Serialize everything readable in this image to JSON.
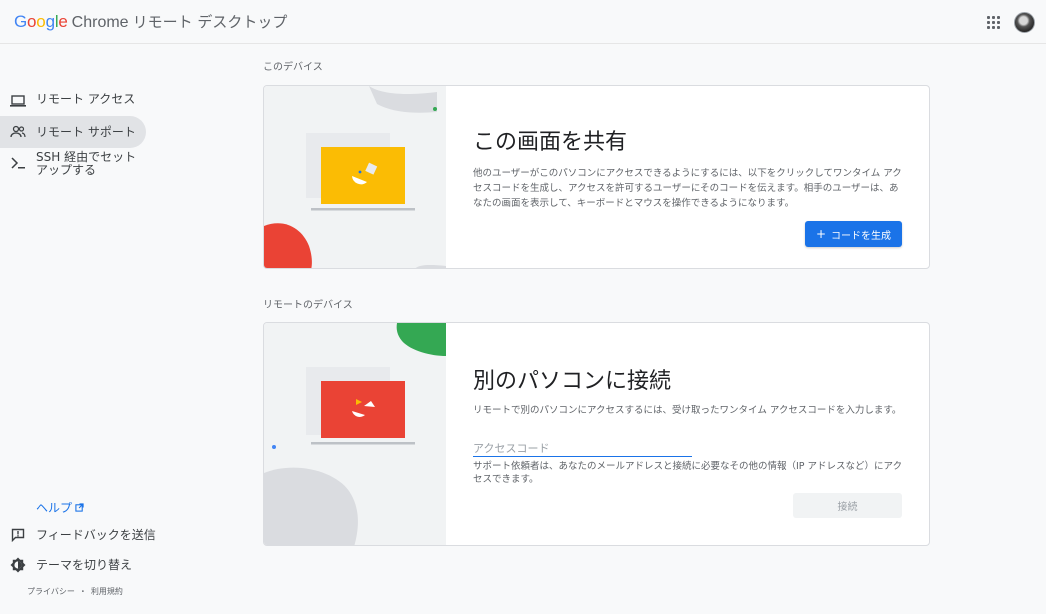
{
  "header": {
    "logo_google": "Google",
    "logo_chrome": "Chrome",
    "logo_rest": "リモート デスクトップ",
    "google_colors": [
      "#4285f4",
      "#ea4335",
      "#fbbc05",
      "#4285f4",
      "#34a853",
      "#ea4335"
    ]
  },
  "sidebar": {
    "items": [
      {
        "label": "リモート アクセス",
        "icon": "laptop-icon",
        "active": false
      },
      {
        "label": "リモート サポート",
        "icon": "people-icon",
        "active": true
      },
      {
        "label": "SSH 経由でセットアップする",
        "icon": "terminal-icon",
        "active": false
      }
    ],
    "help": "ヘルプ",
    "feedback": "フィードバックを送信",
    "theme": "テーマを切り替え",
    "privacy": "プライバシー",
    "separator": "・",
    "terms": "利用規約"
  },
  "main": {
    "this_device_label": "このデバイス",
    "share": {
      "title": "この画面を共有",
      "description": "他のユーザーがこのパソコンにアクセスできるようにするには、以下をクリックしてワンタイム アクセスコードを生成し、アクセスを許可するユーザーにそのコードを伝えます。相手のユーザーは、あなたの画面を表示して、キーボードとマウスを操作できるようになります。",
      "button_icon": "+",
      "button_label": "コードを生成"
    },
    "remote_device_label": "リモートのデバイス",
    "connect": {
      "title": "別のパソコンに接続",
      "description": "リモートで別のパソコンにアクセスするには、受け取ったワンタイム アクセスコードを入力します。",
      "input_placeholder": "アクセスコード",
      "input_value": "",
      "helper": "サポート依頼者は、あなたのメールアドレスと接続に必要なその他の情報（IP アドレスなど）にアクセスできます。",
      "button_label": "接続"
    }
  },
  "colors": {
    "accent": "#1a73e8",
    "yellow": "#fbbc04",
    "red": "#ea4335",
    "green": "#34a853"
  }
}
